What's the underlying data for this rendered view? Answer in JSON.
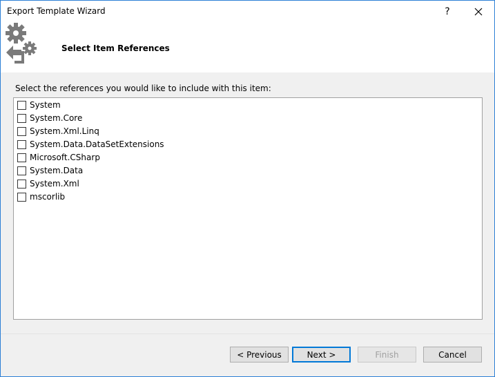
{
  "window": {
    "title": "Export Template Wizard",
    "help_glyph": "?",
    "close_glyph": "✕"
  },
  "header": {
    "title": "Select Item References",
    "icon": "gears-arrow-icon"
  },
  "main": {
    "instruction": "Select the references you would like to include with this item:",
    "references": [
      {
        "label": "System",
        "checked": false
      },
      {
        "label": "System.Core",
        "checked": false
      },
      {
        "label": "System.Xml.Linq",
        "checked": false
      },
      {
        "label": "System.Data.DataSetExtensions",
        "checked": false
      },
      {
        "label": "Microsoft.CSharp",
        "checked": false
      },
      {
        "label": "System.Data",
        "checked": false
      },
      {
        "label": "System.Xml",
        "checked": false
      },
      {
        "label": "mscorlib",
        "checked": false
      }
    ]
  },
  "buttons": {
    "previous": "< Previous",
    "next": "Next >",
    "finish": "Finish",
    "cancel": "Cancel"
  },
  "colors": {
    "accent": "#0078d7",
    "icon": "#7a7a7a"
  }
}
